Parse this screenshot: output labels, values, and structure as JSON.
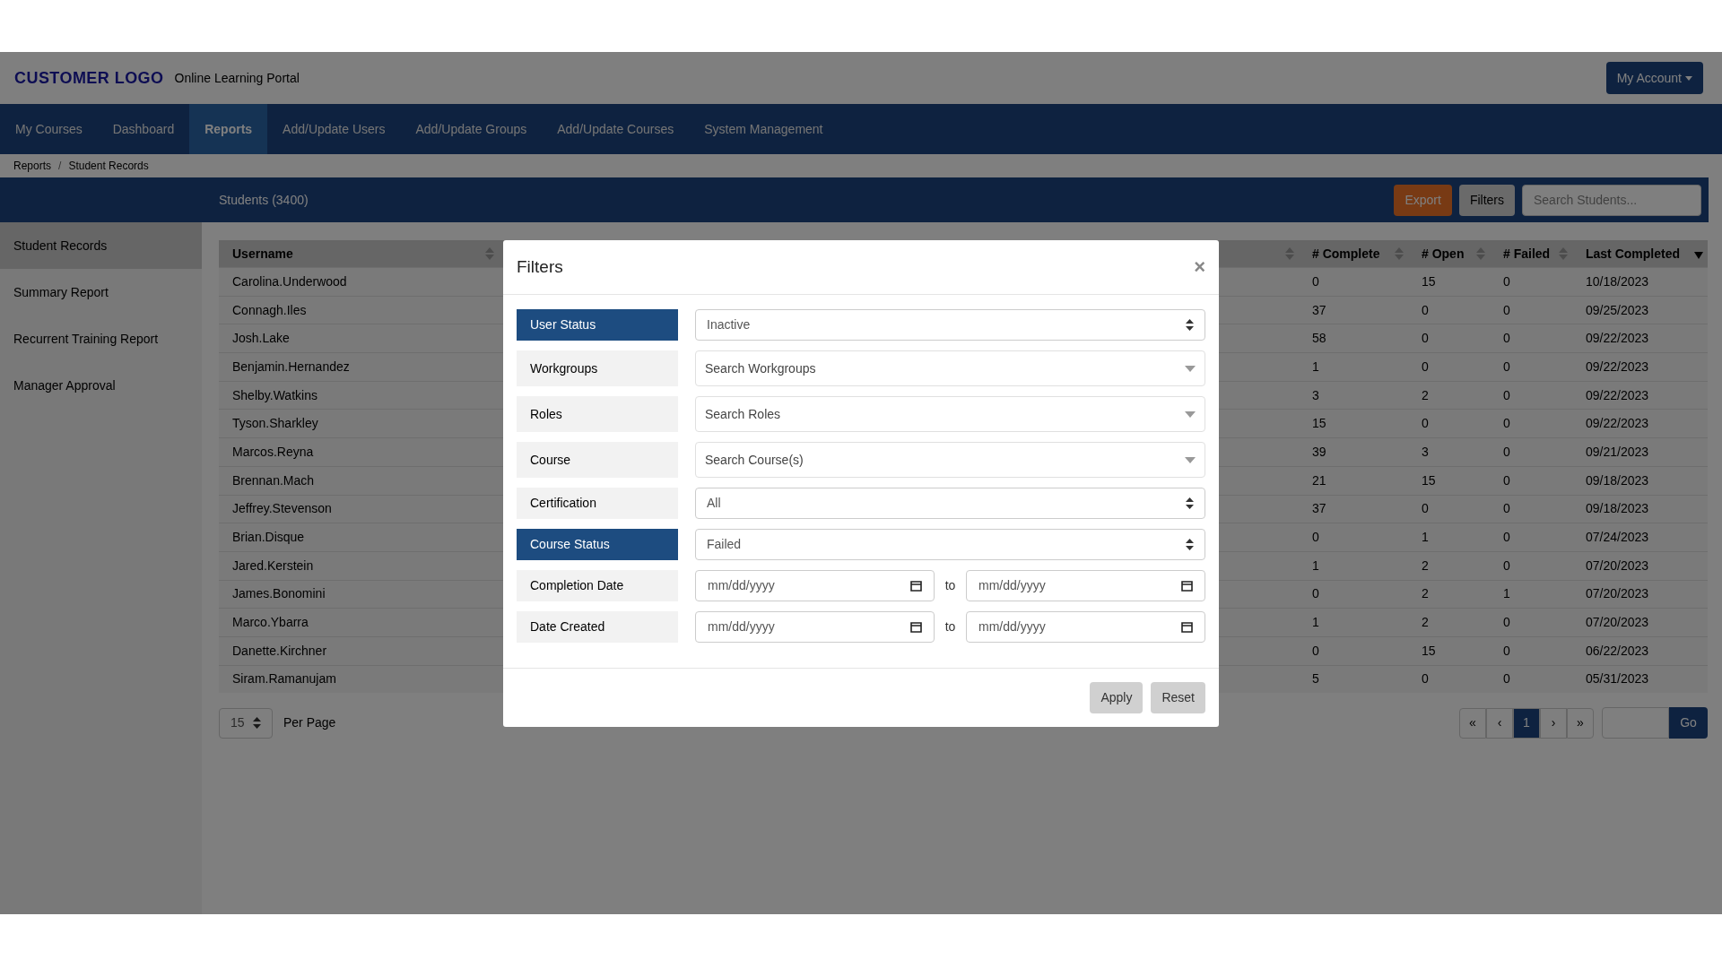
{
  "header": {
    "logo": "CUSTOMER LOGO",
    "portal": "Online Learning Portal",
    "account_button": "My Account"
  },
  "nav": [
    {
      "label": "My Courses",
      "selected": false
    },
    {
      "label": "Dashboard",
      "selected": false
    },
    {
      "label": "Reports",
      "selected": true
    },
    {
      "label": "Add/Update Users",
      "selected": false
    },
    {
      "label": "Add/Update Groups",
      "selected": false
    },
    {
      "label": "Add/Update Courses",
      "selected": false
    },
    {
      "label": "System Management",
      "selected": false
    }
  ],
  "breadcrumb": {
    "items": [
      "Reports",
      "Student Records"
    ],
    "separator": "/"
  },
  "toolbar": {
    "title": "Students (3400)",
    "export_button": "Export",
    "filters_button": "Filters",
    "search": {
      "placeholder": "Search Students..."
    }
  },
  "sidebar": {
    "items": [
      {
        "label": "Student Records",
        "selected": true
      },
      {
        "label": "Summary Report",
        "selected": false
      },
      {
        "label": "Recurrent Training Report",
        "selected": false
      },
      {
        "label": "Manager Approval",
        "selected": false
      }
    ]
  },
  "table": {
    "columns": [
      {
        "label": "Username",
        "sorted": false
      },
      {
        "sorted": false
      },
      {
        "label": "# Complete",
        "sorted": false
      },
      {
        "label": "# Open",
        "sorted": false
      },
      {
        "label": "# Failed",
        "sorted": false
      },
      {
        "label": "Last Completed",
        "sorted": true
      }
    ],
    "rows": [
      [
        "Carolina.Underwood",
        "",
        "0",
        "15",
        "0",
        "10/18/2023"
      ],
      [
        "Connagh.Iles",
        "",
        "37",
        "0",
        "0",
        "09/25/2023"
      ],
      [
        "Josh.Lake",
        "",
        "58",
        "0",
        "0",
        "09/22/2023"
      ],
      [
        "Benjamin.Hernandez",
        "",
        "1",
        "0",
        "0",
        "09/22/2023"
      ],
      [
        "Shelby.Watkins",
        "",
        "3",
        "2",
        "0",
        "09/22/2023"
      ],
      [
        "Tyson.Sharkley",
        "",
        "15",
        "0",
        "0",
        "09/22/2023"
      ],
      [
        "Marcos.Reyna",
        "",
        "39",
        "3",
        "0",
        "09/21/2023"
      ],
      [
        "Brennan.Mach",
        "",
        "21",
        "15",
        "0",
        "09/18/2023"
      ],
      [
        "Jeffrey.Stevenson",
        "",
        "37",
        "0",
        "0",
        "09/18/2023"
      ],
      [
        "Brian.Disque",
        "",
        "0",
        "1",
        "0",
        "07/24/2023"
      ],
      [
        "Jared.Kerstein",
        "",
        "1",
        "2",
        "0",
        "07/20/2023"
      ],
      [
        "James.Bonomini",
        "",
        "0",
        "2",
        "1",
        "07/20/2023"
      ],
      [
        "Marco.Ybarra",
        "",
        "1",
        "2",
        "0",
        "07/20/2023"
      ],
      [
        "Danette.Kirchner",
        "",
        "0",
        "15",
        "0",
        "06/22/2023"
      ],
      [
        "Siram.Ramanujam",
        "",
        "5",
        "0",
        "0",
        "05/31/2023"
      ]
    ]
  },
  "pagination": {
    "per_page_value": "15",
    "per_page_label": "Per Page",
    "first": "«",
    "prev": "‹",
    "pages": [
      {
        "label": "1",
        "selected": true
      }
    ],
    "next": "›",
    "last": "»",
    "go_button": "Go"
  },
  "modal": {
    "title": "Filters",
    "close": "×",
    "filters": [
      {
        "label": "User Status",
        "active": true,
        "kind": "select",
        "value": "Inactive"
      },
      {
        "label": "Workgroups",
        "active": false,
        "kind": "search",
        "placeholder": "Search Workgroups"
      },
      {
        "label": "Roles",
        "active": false,
        "kind": "search",
        "placeholder": "Search Roles"
      },
      {
        "label": "Course",
        "active": false,
        "kind": "search",
        "placeholder": "Search Course(s)"
      },
      {
        "label": "Certification",
        "active": false,
        "kind": "select",
        "value": "All"
      },
      {
        "label": "Course Status",
        "active": true,
        "kind": "select",
        "value": "Failed"
      },
      {
        "label": "Completion Date",
        "active": false,
        "kind": "daterange",
        "from": "mm/dd/yyyy",
        "to_label": "to",
        "to": "mm/dd/yyyy"
      },
      {
        "label": "Date Created",
        "active": false,
        "kind": "daterange",
        "from": "mm/dd/yyyy",
        "to_label": "to",
        "to": "mm/dd/yyyy"
      }
    ],
    "buttons": [
      "Apply",
      "Reset"
    ]
  }
}
